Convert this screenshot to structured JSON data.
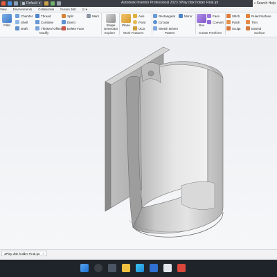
{
  "quick_access": {
    "dropdown1": "Default",
    "dropdown2": ""
  },
  "window": {
    "title": "Autodesk Inventor Professional 2023    3Play disk holder Final.ipt"
  },
  "search": {
    "label": "Search Help"
  },
  "menu_tabs": [
    "View",
    "Environments",
    "Collaborate",
    "Fusion 360"
  ],
  "ribbon": {
    "modify": {
      "group": "Modify",
      "fillet": "Fillet",
      "chamfer": "Chamfer",
      "shell": "Shell",
      "draft": "Draft",
      "thread": "Thread",
      "combine": "Combine",
      "thicken": "Thicken/ Offset",
      "split": "Split",
      "direct": "Direct",
      "delete_face": "Delete Face",
      "mark": "Mark"
    },
    "explore": {
      "group": "Explore",
      "shape_generator": "Shape Generator"
    },
    "work_features": {
      "group": "Work Features",
      "plane": "Plane",
      "axis": "Axis",
      "point": "Point",
      "ucs": "UCS"
    },
    "pattern": {
      "group": "Pattern",
      "rectangular": "Rectangular",
      "circular": "Circular",
      "sketch_driven": "Sketch Driven",
      "mirror": "Mirror"
    },
    "freeform": {
      "group": "Create Freeform",
      "box": "Box",
      "face": "Face",
      "convert": "Convert"
    },
    "surface": {
      "group": "Surface",
      "stitch": "Stitch",
      "patch": "Patch",
      "sculpt": "Sculpt",
      "ruled_surface": "Ruled Surface",
      "trim": "Trim",
      "extend": "Extend"
    }
  },
  "document_tab": {
    "label": "3Play disk holder Final.ipt",
    "close": "×"
  },
  "colors": {
    "accent": "#2e7cd6",
    "model_light": "#dcdcdc",
    "model_dark": "#9c9c9c",
    "taskbar": "#1f242b"
  }
}
